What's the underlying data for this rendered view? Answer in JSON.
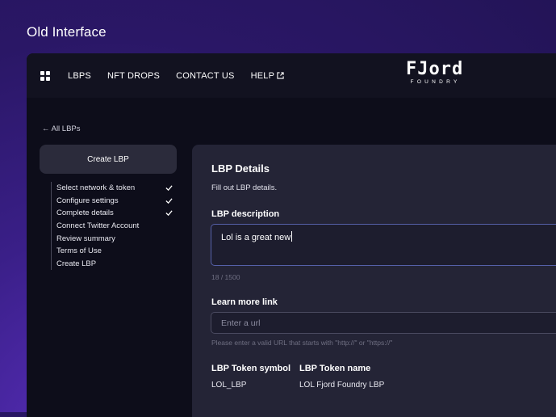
{
  "caption": "Old Interface",
  "nav": {
    "items": [
      "LBPS",
      "NFT DROPS",
      "CONTACT US",
      "HELP"
    ]
  },
  "logo": {
    "main": "FJord",
    "sub": "FOUNDRY"
  },
  "back_link": "← All LBPs",
  "sidebar": {
    "create_button": "Create LBP",
    "steps": [
      {
        "label": "Select network & token",
        "done": true
      },
      {
        "label": "Configure settings",
        "done": true
      },
      {
        "label": "Complete details",
        "done": true
      },
      {
        "label": "Connect Twitter Account",
        "done": false
      },
      {
        "label": "Review summary",
        "done": false
      },
      {
        "label": "Terms of Use",
        "done": false
      },
      {
        "label": "Create LBP",
        "done": false
      }
    ]
  },
  "panel": {
    "title": "LBP Details",
    "subtitle": "Fill out LBP details.",
    "description_label": "LBP description",
    "description_value": "Lol is a great new",
    "char_counter": "18 / 1500",
    "link_label": "Learn more link",
    "link_placeholder": "Enter a url",
    "link_hint": "Please enter a valid URL that starts with \"http://\" or \"https://\"",
    "token_symbol_label": "LBP Token symbol",
    "token_symbol_value": "LOL_LBP",
    "token_name_label": "LBP Token name",
    "token_name_value": "LOL Fjord Foundry LBP"
  }
}
